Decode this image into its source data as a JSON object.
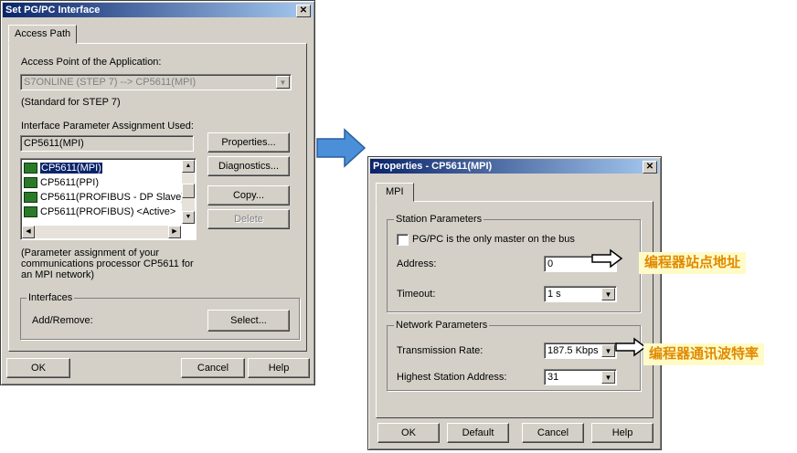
{
  "left_dialog": {
    "title": "Set PG/PC Interface",
    "tab": "Access Path",
    "access_point_label": "Access Point of the Application:",
    "access_point_value": "S7ONLINE     (STEP 7)     --> CP5611(MPI)",
    "standard_note": "(Standard for STEP 7)",
    "param_assignment_label": "Interface Parameter Assignment Used:",
    "param_assignment_value": "CP5611(MPI)",
    "list_items": [
      "CP5611(MPI)",
      "CP5611(PPI)",
      "CP5611(PROFIBUS - DP Slave)",
      "CP5611(PROFIBUS)  <Active>"
    ],
    "buttons": {
      "properties": "Properties...",
      "diagnostics": "Diagnostics...",
      "copy": "Copy...",
      "delete": "Delete",
      "select": "Select...",
      "ok": "OK",
      "cancel": "Cancel",
      "help": "Help"
    },
    "description": "(Parameter assignment of your communications processor CP5611 for an MPI network)",
    "interfaces_group": "Interfaces",
    "add_remove_label": "Add/Remove:"
  },
  "right_dialog": {
    "title": "Properties - CP5611(MPI)",
    "tab": "MPI",
    "station_group": "Station Parameters",
    "only_master_label": "PG/PC is the only master on the bus",
    "only_master_checked": false,
    "address_label": "Address:",
    "address_value": "0",
    "timeout_label": "Timeout:",
    "timeout_value": "1 s",
    "network_group": "Network Parameters",
    "rate_label": "Transmission Rate:",
    "rate_value": "187.5 Kbps",
    "highest_label": "Highest Station Address:",
    "highest_value": "31",
    "buttons": {
      "ok": "OK",
      "default": "Default",
      "cancel": "Cancel",
      "help": "Help"
    }
  },
  "annotations": {
    "station_address": "编程器站点地址",
    "baud_rate": "编程器通讯波特率"
  },
  "colors": {
    "titlebar": "#0a246a",
    "dialog_bg": "#d4d0c8",
    "annotation_text": "#e08a00",
    "annotation_bg": "#fffbc8",
    "flow_arrow": "#4a8fd8"
  }
}
